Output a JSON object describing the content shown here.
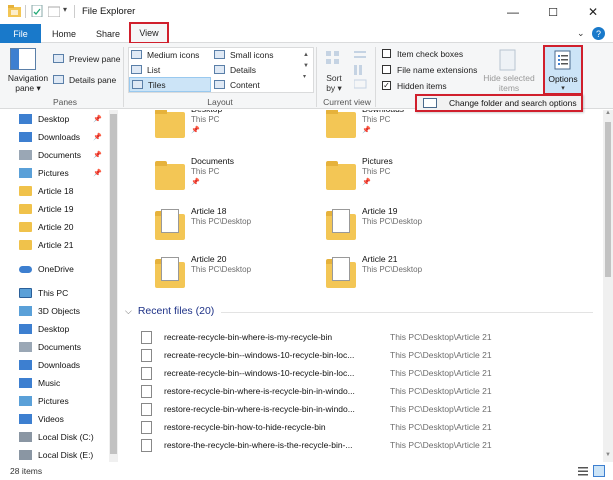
{
  "window": {
    "title": "File Explorer",
    "minimize": "—",
    "maximize": "☐",
    "close": "✕"
  },
  "tabs": {
    "file": "File",
    "home": "Home",
    "share": "Share",
    "view": "View",
    "help": "?"
  },
  "ribbon": {
    "panes": {
      "navigation_pane": "Navigation",
      "navigation_pane_2": "pane ▾",
      "preview_pane": "Preview pane",
      "details_pane": "Details pane",
      "label": "Panes"
    },
    "layout": {
      "medium_icons": "Medium icons",
      "small_icons": "Small icons",
      "list": "List",
      "details": "Details",
      "tiles": "Tiles",
      "content": "Content",
      "label": "Layout"
    },
    "current_view": {
      "sort_by": "Sort",
      "sort_by_2": "by ▾",
      "label": "Current view"
    },
    "show_hide": {
      "item_check_boxes": "Item check boxes",
      "file_name_extensions": "File name extensions",
      "hidden_items": "Hidden items",
      "hide_selected": "Hide selected",
      "hide_selected_2": "items"
    },
    "options": {
      "label": "Options",
      "arrow": "▾"
    }
  },
  "dropdown": {
    "change_folder_options": "Change folder and search options"
  },
  "nav": {
    "quick_access": [
      {
        "label": "Desktop",
        "icon": "desktop-icon",
        "pinned": true
      },
      {
        "label": "Downloads",
        "icon": "downloads-icon",
        "pinned": true
      },
      {
        "label": "Documents",
        "icon": "documents-icon",
        "pinned": true
      },
      {
        "label": "Pictures",
        "icon": "pictures-icon",
        "pinned": true
      },
      {
        "label": "Article 18",
        "icon": "folder-icon",
        "pinned": false
      },
      {
        "label": "Article 19",
        "icon": "folder-icon",
        "pinned": false
      },
      {
        "label": "Article 20",
        "icon": "folder-icon",
        "pinned": false
      },
      {
        "label": "Article 21",
        "icon": "folder-icon",
        "pinned": false
      }
    ],
    "onedrive": "OneDrive",
    "this_pc": "This PC",
    "this_pc_items": [
      {
        "label": "3D Objects",
        "icon": "3d-objects-icon"
      },
      {
        "label": "Desktop",
        "icon": "desktop-icon"
      },
      {
        "label": "Documents",
        "icon": "documents-icon"
      },
      {
        "label": "Downloads",
        "icon": "downloads-icon"
      },
      {
        "label": "Music",
        "icon": "music-icon"
      },
      {
        "label": "Pictures",
        "icon": "pictures-icon"
      },
      {
        "label": "Videos",
        "icon": "videos-icon"
      },
      {
        "label": "Local Disk (C:)",
        "icon": "drive-icon"
      },
      {
        "label": "Local Disk (E:)",
        "icon": "drive-icon"
      }
    ]
  },
  "tiles": [
    {
      "name": "Desktop",
      "sub": "This PC",
      "pinned": true
    },
    {
      "name": "Downloads",
      "sub": "This PC",
      "pinned": true
    },
    {
      "name": "Documents",
      "sub": "This PC",
      "pinned": true
    },
    {
      "name": "Pictures",
      "sub": "This PC",
      "pinned": true
    },
    {
      "name": "Article 18",
      "sub": "This PC\\Desktop",
      "pinned": false
    },
    {
      "name": "Article 19",
      "sub": "This PC\\Desktop",
      "pinned": false
    },
    {
      "name": "Article 20",
      "sub": "This PC\\Desktop",
      "pinned": false
    },
    {
      "name": "Article 21",
      "sub": "This PC\\Desktop",
      "pinned": false
    }
  ],
  "recent": {
    "header": "Recent files (20)",
    "files": [
      {
        "name": "recreate-recycle-bin-where-is-my-recycle-bin",
        "location": "This PC\\Desktop\\Article 21"
      },
      {
        "name": "recreate-recycle-bin--windows-10-recycle-bin-loc...",
        "location": "This PC\\Desktop\\Article 21"
      },
      {
        "name": "recreate-recycle-bin--windows-10-recycle-bin-loc...",
        "location": "This PC\\Desktop\\Article 21"
      },
      {
        "name": "restore-recycle-bin-where-is-recycle-bin-in-windo...",
        "location": "This PC\\Desktop\\Article 21"
      },
      {
        "name": "restore-recycle-bin-where-is-recycle-bin-in-windo...",
        "location": "This PC\\Desktop\\Article 21"
      },
      {
        "name": "restore-recycle-bin-how-to-hide-recycle-bin",
        "location": "This PC\\Desktop\\Article 21"
      },
      {
        "name": "restore-the-recycle-bin-where-is-the-recycle-bin-...",
        "location": "This PC\\Desktop\\Article 21"
      }
    ]
  },
  "status": {
    "items": "28 items"
  },
  "colors": {
    "accent": "#1979ca",
    "highlight_red": "#d01f2c",
    "folder": "#f3c655"
  }
}
